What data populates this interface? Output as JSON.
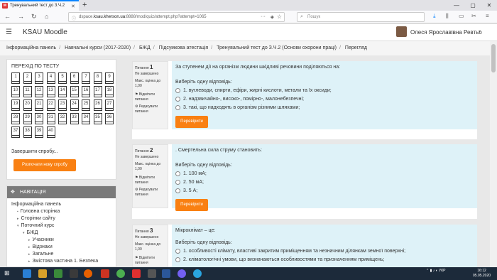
{
  "browser": {
    "tab_title": "Тренувальний тест до 3.Ч.2",
    "tab_favicon": "M",
    "url_prefix": "dspace.",
    "url_domain": "ksau.kherson.ua",
    "url_suffix": ":8888/mod/quiz/attempt.php?attempt=1065",
    "search_placeholder": "Пошук"
  },
  "header": {
    "site_name": "KSAU Moodle",
    "user_name": "Олеся Ярославівна Ревтьо"
  },
  "breadcrumb": [
    "Інформаційна панель",
    "Навчальні курси (2017-2020)",
    "БЖД",
    "Підсумкова атестація",
    "Тренувальний тест до З.Ч.2 (Основи охорони праці)",
    "Перегляд"
  ],
  "quiz_nav": {
    "title": "ПЕРЕХІД ПО ТЕСТУ",
    "numbers": [
      "1",
      "2",
      "3",
      "4",
      "5",
      "6",
      "7",
      "8",
      "9",
      "10",
      "11",
      "12",
      "13",
      "14",
      "15",
      "16",
      "17",
      "18",
      "19",
      "20",
      "21",
      "22",
      "23",
      "24",
      "25",
      "26",
      "27",
      "28",
      "29",
      "30",
      "31",
      "32",
      "33",
      "34",
      "35",
      "36",
      "37",
      "38",
      "39",
      "40"
    ],
    "finish_label": "Завершити спробу...",
    "new_attempt_label": "Розпочати нову спробу"
  },
  "nav_block": {
    "title": "НАВІГАЦІЯ",
    "items": [
      {
        "label": "Інформаційна панель",
        "level": 0,
        "arrow": ""
      },
      {
        "label": "Головна сторінка",
        "level": 1,
        "arrow": "▪"
      },
      {
        "label": "Сторінки сайту",
        "level": 1,
        "arrow": "▸"
      },
      {
        "label": "Поточний курс",
        "level": 1,
        "arrow": "▾"
      },
      {
        "label": "БЖД",
        "level": 2,
        "arrow": "▾"
      },
      {
        "label": "Учасники",
        "level": 3,
        "arrow": "▸"
      },
      {
        "label": "Відзнаки",
        "level": 3,
        "arrow": "▸"
      },
      {
        "label": "Загальне",
        "level": 3,
        "arrow": "▸"
      },
      {
        "label": "Змістова частина 1. Безпека",
        "level": 3,
        "arrow": "▸"
      }
    ]
  },
  "questions": [
    {
      "label": "Питання",
      "number": "1",
      "state": "Не завершено",
      "grade": "Макс. оцінка до 1,00",
      "flag": "Відмітити питання",
      "edit": "Редагувати питання",
      "text": "За ступенем дії на організм людини шкідливі речовини поділяються на:",
      "prompt": "Виберіть одну відповідь:",
      "options": [
        "1. вуглеводи, спирти, ефіри, жирні кислоти, метали та їх оксиди;",
        "2. надзвичайно-, високо-, помірно-, малонебезпечні;",
        "3. такі, що надходять в організм різними шляхами;"
      ],
      "button": "Перевірити"
    },
    {
      "label": "Питання",
      "number": "2",
      "state": "Не завершено",
      "grade": "Макс. оцінка до 1,00",
      "flag": "Відмітити питання",
      "edit": "Редагувати питання",
      "text": ". Смертельна сила струму становить:",
      "prompt": "Виберіть одну відповідь:",
      "options": [
        "1. 100 мА;",
        "2. 50 мА;",
        "3. 5 А;"
      ],
      "button": "Перевірити"
    },
    {
      "label": "Питання",
      "number": "3",
      "state": "Не завершено",
      "grade": "Макс. оцінка до 1,00",
      "flag": "Відмітити питання",
      "edit": "",
      "text": "Мікроклімат – це:",
      "prompt": "Виберіть одну відповідь:",
      "options": [
        "1. особливості клімату, властиві закритим приміщенням та незначним ділянкам земної поверхні;",
        "2. кліматологічні умови, що визначаються особливостями та призначенням приміщень;"
      ],
      "button": ""
    }
  ],
  "taskbar": {
    "lang": "УКР",
    "time": "16:12",
    "date": "05.05.2020"
  }
}
